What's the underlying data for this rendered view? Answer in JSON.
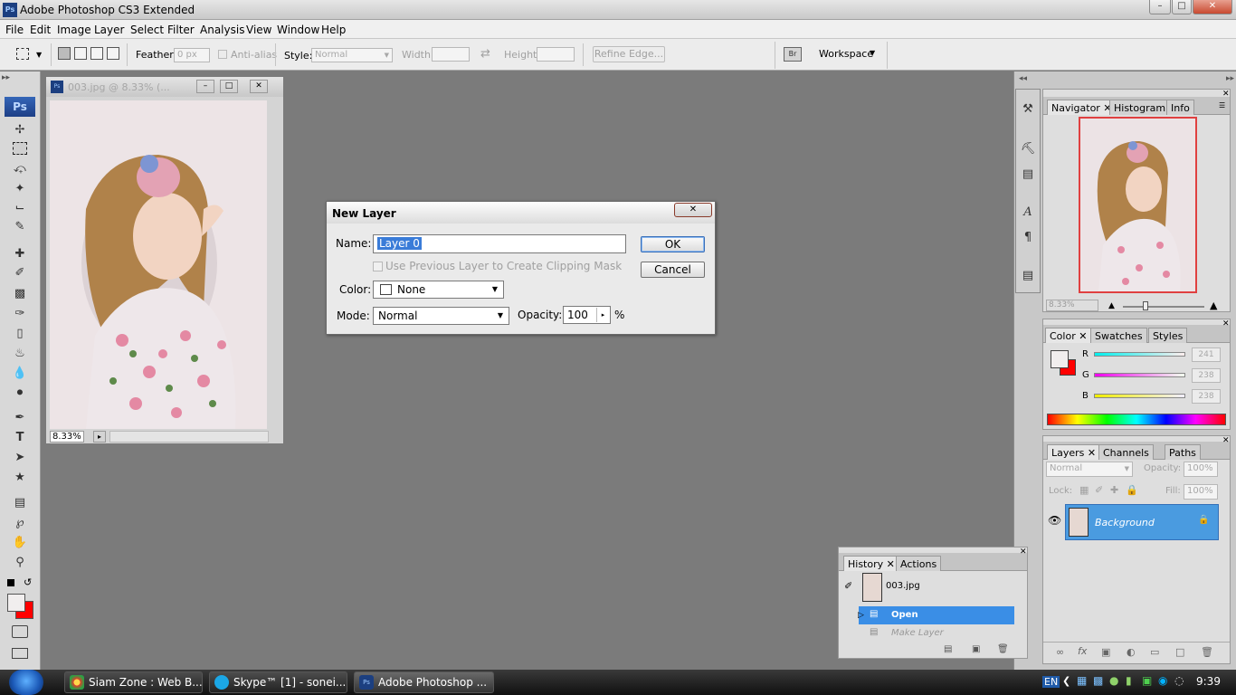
{
  "app": {
    "title": "Adobe Photoshop CS3 Extended",
    "ps_label": "Ps"
  },
  "menu": [
    "File",
    "Edit",
    "Image",
    "Layer",
    "Select",
    "Filter",
    "Analysis",
    "View",
    "Window",
    "Help"
  ],
  "options": {
    "feather_label": "Feather:",
    "feather_value": "0 px",
    "antialias_label": "Anti-alias",
    "style_label": "Style:",
    "style_value": "Normal",
    "width_label": "Width:",
    "height_label": "Height:",
    "refine_edge": "Refine Edge...",
    "workspace": "Workspace"
  },
  "document": {
    "title": "003.jpg @ 8.33% (...",
    "zoom": "8.33%"
  },
  "dialog": {
    "title": "New Layer",
    "name_label": "Name:",
    "name_value": "Layer 0",
    "clip_label": "Use Previous Layer to Create Clipping Mask",
    "color_label": "Color:",
    "color_value": "None",
    "mode_label": "Mode:",
    "mode_value": "Normal",
    "opacity_label": "Opacity:",
    "opacity_value": "100",
    "opacity_unit": "%",
    "ok": "OK",
    "cancel": "Cancel"
  },
  "navigator": {
    "tabs": [
      "Navigator",
      "Histogram",
      "Info"
    ],
    "zoom": "8.33%"
  },
  "color_panel": {
    "tabs": [
      "Color",
      "Swatches",
      "Styles"
    ],
    "r_label": "R",
    "g_label": "G",
    "b_label": "B",
    "r": "241",
    "g": "238",
    "b": "238"
  },
  "layers_panel": {
    "tabs": [
      "Layers",
      "Channels",
      "Paths"
    ],
    "blend": "Normal",
    "opacity_label": "Opacity:",
    "opacity": "100%",
    "lock_label": "Lock:",
    "fill_label": "Fill:",
    "fill": "100%",
    "layer_name": "Background"
  },
  "history_panel": {
    "tabs": [
      "History",
      "Actions"
    ],
    "snapshot": "003.jpg",
    "items": [
      "Open",
      "Make Layer"
    ]
  },
  "taskbar": {
    "items": [
      "Siam Zone : Web B...",
      "Skype™ [1] - sonei...",
      "Adobe Photoshop ..."
    ],
    "lang": "EN",
    "time": "9:39"
  },
  "colors": {
    "highlight": "#3a8ee6",
    "selection": "#4a9be0"
  }
}
